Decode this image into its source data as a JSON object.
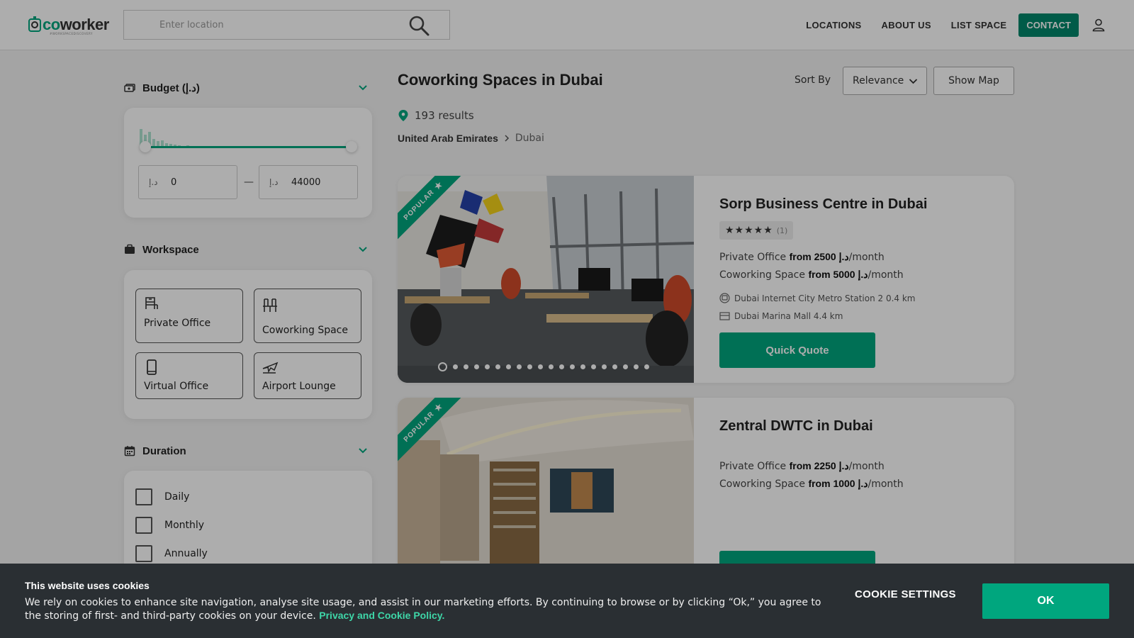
{
  "header": {
    "logo_text_a": "co",
    "logo_text_b": "worker",
    "logo_sub": "#WORKSPACEDISCOVERY",
    "search_placeholder": "Enter location",
    "nav": [
      "LOCATIONS",
      "ABOUT US",
      "LIST SPACE"
    ],
    "contact_label": "CONTACT"
  },
  "filters": {
    "budget": {
      "title": "Budget (د.إ)",
      "currency": "د.إ",
      "min": "0",
      "max": "44000",
      "dash": "—",
      "selected_min": 0,
      "selected_max": 44000
    },
    "workspace": {
      "title": "Workspace",
      "options": [
        "Private Office",
        "Coworking Space",
        "Virtual Office",
        "Airport Lounge"
      ]
    },
    "duration": {
      "title": "Duration",
      "options": [
        "Daily",
        "Monthly",
        "Annually"
      ]
    }
  },
  "main": {
    "title": "Coworking Spaces in Dubai",
    "sort_label": "Sort By",
    "sort_value": "Relevance",
    "show_map": "Show Map",
    "results": "193 results",
    "breadcrumb": [
      "United Arab Emirates",
      "Dubai"
    ]
  },
  "listings": [
    {
      "badge": "POPULAR",
      "title": "Sorp Business Centre in Dubai",
      "stars": "★★★★★",
      "rating_count": "(1)",
      "price_private_label": "Private Office",
      "price_private_from": "from 2500 د.إ",
      "price_private_unit": "/month",
      "price_cowork_label": "Coworking Space",
      "price_cowork_from": "from 5000 د.إ",
      "price_cowork_unit": "/month",
      "nearby": [
        "Dubai Internet City Metro Station 2  0.4 km",
        "Dubai Marina Mall  4.4 km"
      ],
      "quote": "Quick Quote"
    },
    {
      "badge": "POPULAR",
      "title": "Zentral DWTC in Dubai",
      "price_private_label": "Private Office",
      "price_private_from": "from 2250 د.إ",
      "price_private_unit": "/month",
      "price_cowork_label": "Coworking Space",
      "price_cowork_from": "from 1000 د.إ",
      "price_cowork_unit": "/month"
    }
  ],
  "cookie": {
    "title": "This website uses cookies",
    "text": "We rely on cookies to enhance site navigation, analyse site usage, and assist in our marketing efforts. By continuing to browse or by clicking “Ok,” you agree to the storing of first- and third-party cookies on your device.",
    "policy_link": "Privacy and Cookie Policy.",
    "settings": "COOKIE SETTINGS",
    "ok": "OK"
  },
  "colors": {
    "brand": "#00a67e",
    "contact": "#00876b",
    "cookie_bg": "#2a2f33",
    "link": "#3ed6a8"
  }
}
